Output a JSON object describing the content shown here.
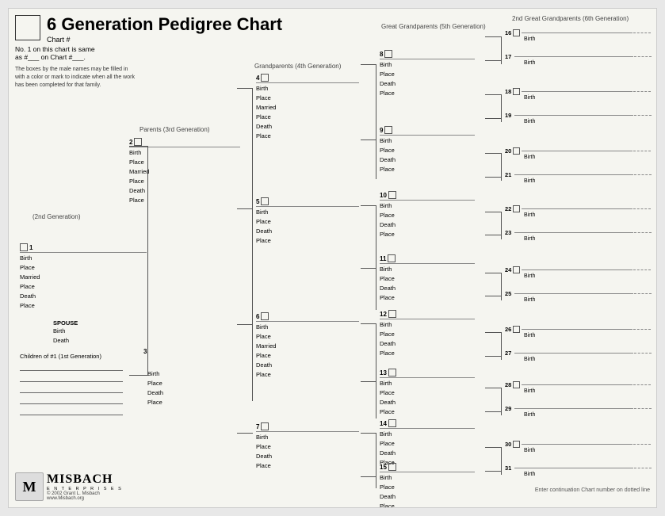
{
  "title": "6 Generation Pedigree Chart",
  "chart_num_label": "Chart #",
  "same_as_line1": "No. 1 on this chart is same",
  "same_as_line2": "as #___ on Chart #___.",
  "instructions": "The boxes by the male names may be filled in with a color or mark to indicate when all the work has been completed for that family.",
  "gen_labels": {
    "gen2": "(2nd Generation)",
    "gen3": "Parents (3rd Generation)",
    "gen4": "Grandparents (4th Generation)",
    "gen5": "Great Grandparents (5th Generation)",
    "gen6": "2nd Great Grandparents (6th Generation)"
  },
  "fields": {
    "birth": "Birth",
    "place": "Place",
    "married": "Married",
    "death": "Death"
  },
  "person1": {
    "num": "1",
    "fields": [
      "Birth",
      "Place",
      "Married",
      "Place",
      "Death",
      "Place"
    ]
  },
  "person2": {
    "num": "2",
    "fields": [
      "Birth",
      "Place",
      "Married",
      "Place",
      "Death",
      "Place"
    ]
  },
  "person3": {
    "num": "3",
    "fields": [
      "Birth",
      "Place",
      "Death",
      "Place"
    ]
  },
  "person4": {
    "num": "4",
    "fields": [
      "Birth",
      "Place",
      "Married",
      "Place",
      "Death",
      "Place"
    ]
  },
  "person5": {
    "num": "5",
    "fields": [
      "Birth",
      "Place",
      "Death",
      "Place"
    ]
  },
  "person6": {
    "num": "6",
    "fields": [
      "Birth",
      "Place",
      "Married",
      "Place",
      "Death",
      "Place"
    ]
  },
  "person7": {
    "num": "7",
    "fields": [
      "Birth",
      "Place",
      "Death",
      "Place"
    ]
  },
  "persons_8_15": [
    {
      "num": "8",
      "fields": [
        "Birth",
        "Place",
        "Death",
        "Place"
      ]
    },
    {
      "num": "9",
      "fields": [
        "Birth",
        "Place",
        "Death",
        "Place"
      ]
    },
    {
      "num": "10",
      "fields": [
        "Birth",
        "Place",
        "Death",
        "Place"
      ]
    },
    {
      "num": "11",
      "fields": [
        "Birth",
        "Place",
        "Death",
        "Place"
      ]
    },
    {
      "num": "12",
      "fields": [
        "Birth",
        "Place",
        "Death",
        "Place"
      ]
    },
    {
      "num": "13",
      "fields": [
        "Birth",
        "Place",
        "Death",
        "Place"
      ]
    },
    {
      "num": "14",
      "fields": [
        "Birth",
        "Place",
        "Death",
        "Place"
      ]
    },
    {
      "num": "15",
      "fields": [
        "Birth",
        "Place",
        "Death",
        "Place"
      ]
    }
  ],
  "persons_16_31": [
    {
      "num": "16",
      "field": "Birth"
    },
    {
      "num": "17",
      "field": "Birth"
    },
    {
      "num": "18",
      "field": "Birth"
    },
    {
      "num": "19",
      "field": "Birth"
    },
    {
      "num": "20",
      "field": "Birth"
    },
    {
      "num": "21",
      "field": "Birth"
    },
    {
      "num": "22",
      "field": "Birth"
    },
    {
      "num": "23",
      "field": "Birth"
    },
    {
      "num": "24",
      "field": "Birth"
    },
    {
      "num": "25",
      "field": "Birth"
    },
    {
      "num": "26",
      "field": "Birth"
    },
    {
      "num": "27",
      "field": "Birth"
    },
    {
      "num": "28",
      "field": "Birth"
    },
    {
      "num": "29",
      "field": "Birth"
    },
    {
      "num": "30",
      "field": "Birth"
    },
    {
      "num": "31",
      "field": "Birth"
    }
  ],
  "spouse_label": "SPOUSE",
  "spouse_fields": [
    "Birth",
    "Death"
  ],
  "children_label": "Children of #1 (1st Generation)",
  "continuation_note": "Enter continuation Chart\nnumber on dotted line",
  "logo": {
    "brand": "MISBACH",
    "sub": "E N T E R P R I S E S",
    "copy": "© 2002 Grant L. Misbach",
    "web": "www.Misbach.org"
  }
}
